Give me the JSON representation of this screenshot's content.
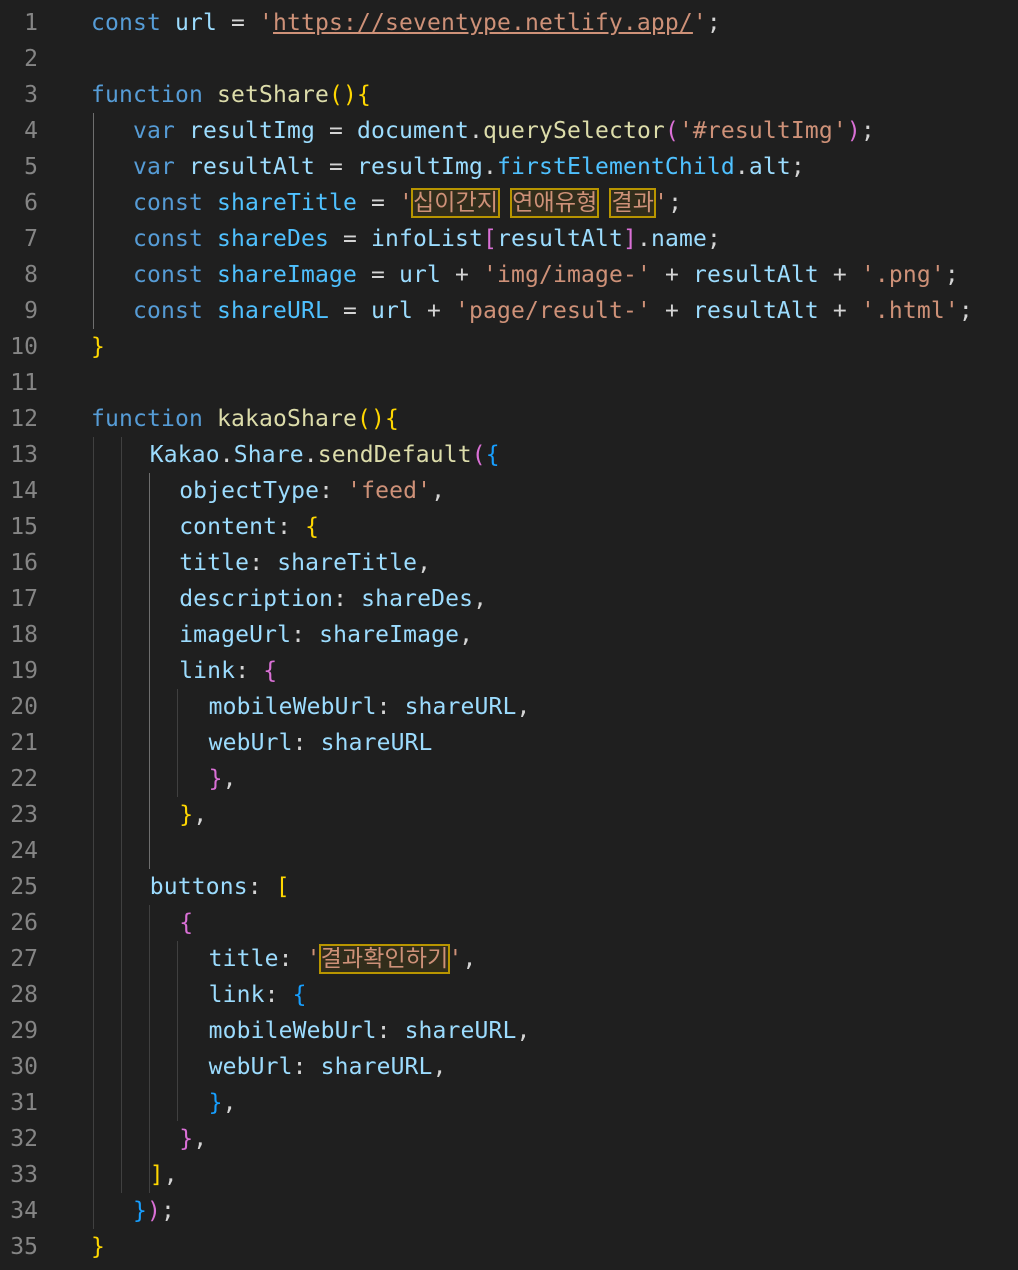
{
  "editor": {
    "lines": [
      {
        "n": "1",
        "tokens": [
          {
            "t": "const",
            "c": "kw"
          },
          {
            "t": " "
          },
          {
            "t": "url",
            "c": "var"
          },
          {
            "t": " = ",
            "c": "op"
          },
          {
            "t": "'",
            "c": "str"
          },
          {
            "t": "https://seventype.netlify.app/",
            "c": "str link"
          },
          {
            "t": "'",
            "c": "str"
          },
          {
            "t": ";",
            "c": "punc"
          }
        ],
        "indent": 0
      },
      {
        "n": "2",
        "tokens": [],
        "indent": 0
      },
      {
        "n": "3",
        "tokens": [
          {
            "t": "function",
            "c": "kw"
          },
          {
            "t": " "
          },
          {
            "t": "setShare",
            "c": "fn"
          },
          {
            "t": "()",
            "c": "b1"
          },
          {
            "t": "{",
            "c": "b1"
          }
        ],
        "indent": 0
      },
      {
        "n": "4",
        "tokens": [
          {
            "t": "var",
            "c": "kw"
          },
          {
            "t": " "
          },
          {
            "t": "resultImg",
            "c": "var"
          },
          {
            "t": " = ",
            "c": "op"
          },
          {
            "t": "document",
            "c": "var"
          },
          {
            "t": ".",
            "c": "punc"
          },
          {
            "t": "querySelector",
            "c": "fn"
          },
          {
            "t": "(",
            "c": "b2"
          },
          {
            "t": "'#resultImg'",
            "c": "str"
          },
          {
            "t": ")",
            "c": "b2"
          },
          {
            "t": ";",
            "c": "punc"
          }
        ],
        "indent": 1
      },
      {
        "n": "5",
        "tokens": [
          {
            "t": "var",
            "c": "kw"
          },
          {
            "t": " "
          },
          {
            "t": "resultAlt",
            "c": "var"
          },
          {
            "t": " = ",
            "c": "op"
          },
          {
            "t": "resultImg",
            "c": "var"
          },
          {
            "t": ".",
            "c": "punc"
          },
          {
            "t": "firstElementChild",
            "c": "const"
          },
          {
            "t": ".",
            "c": "punc"
          },
          {
            "t": "alt",
            "c": "var"
          },
          {
            "t": ";",
            "c": "punc"
          }
        ],
        "indent": 1
      },
      {
        "n": "6",
        "tokens": [
          {
            "t": "const",
            "c": "kw"
          },
          {
            "t": " "
          },
          {
            "t": "shareTitle",
            "c": "const"
          },
          {
            "t": " = ",
            "c": "op"
          },
          {
            "t": "'",
            "c": "str"
          },
          {
            "t": "십이간지",
            "c": "str hl"
          },
          {
            "t": " ",
            "c": "str"
          },
          {
            "t": "연애유형",
            "c": "str hl"
          },
          {
            "t": " ",
            "c": "str"
          },
          {
            "t": "결과",
            "c": "str hl"
          },
          {
            "t": "'",
            "c": "str"
          },
          {
            "t": ";",
            "c": "punc"
          }
        ],
        "indent": 1
      },
      {
        "n": "7",
        "tokens": [
          {
            "t": "const",
            "c": "kw"
          },
          {
            "t": " "
          },
          {
            "t": "shareDes",
            "c": "const"
          },
          {
            "t": " = ",
            "c": "op"
          },
          {
            "t": "infoList",
            "c": "var"
          },
          {
            "t": "[",
            "c": "b2"
          },
          {
            "t": "resultAlt",
            "c": "var"
          },
          {
            "t": "]",
            "c": "b2"
          },
          {
            "t": ".",
            "c": "punc"
          },
          {
            "t": "name",
            "c": "var"
          },
          {
            "t": ";",
            "c": "punc"
          }
        ],
        "indent": 1
      },
      {
        "n": "8",
        "tokens": [
          {
            "t": "const",
            "c": "kw"
          },
          {
            "t": " "
          },
          {
            "t": "shareImage",
            "c": "const"
          },
          {
            "t": " = ",
            "c": "op"
          },
          {
            "t": "url",
            "c": "var"
          },
          {
            "t": " + ",
            "c": "op"
          },
          {
            "t": "'img/image-'",
            "c": "str"
          },
          {
            "t": " + ",
            "c": "op"
          },
          {
            "t": "resultAlt",
            "c": "var"
          },
          {
            "t": " + ",
            "c": "op"
          },
          {
            "t": "'.png'",
            "c": "str"
          },
          {
            "t": ";",
            "c": "punc"
          }
        ],
        "indent": 1
      },
      {
        "n": "9",
        "tokens": [
          {
            "t": "const",
            "c": "kw"
          },
          {
            "t": " "
          },
          {
            "t": "shareURL",
            "c": "const"
          },
          {
            "t": " = ",
            "c": "op"
          },
          {
            "t": "url",
            "c": "var"
          },
          {
            "t": " + ",
            "c": "op"
          },
          {
            "t": "'page/result-'",
            "c": "str"
          },
          {
            "t": " + ",
            "c": "op"
          },
          {
            "t": "resultAlt",
            "c": "var"
          },
          {
            "t": " + ",
            "c": "op"
          },
          {
            "t": "'.html'",
            "c": "str"
          },
          {
            "t": ";",
            "c": "punc"
          }
        ],
        "indent": 1
      },
      {
        "n": "10",
        "tokens": [
          {
            "t": "}",
            "c": "b1"
          }
        ],
        "indent": 0
      },
      {
        "n": "11",
        "tokens": [],
        "indent": 0
      },
      {
        "n": "12",
        "tokens": [
          {
            "t": "function",
            "c": "kw"
          },
          {
            "t": " "
          },
          {
            "t": "kakaoShare",
            "c": "fn"
          },
          {
            "t": "()",
            "c": "b1"
          },
          {
            "t": "{",
            "c": "b1"
          }
        ],
        "indent": 0
      },
      {
        "n": "13",
        "tokens": [
          {
            "t": "Kakao",
            "c": "var"
          },
          {
            "t": ".",
            "c": "punc"
          },
          {
            "t": "Share",
            "c": "var"
          },
          {
            "t": ".",
            "c": "punc"
          },
          {
            "t": "sendDefault",
            "c": "fn"
          },
          {
            "t": "(",
            "c": "b2"
          },
          {
            "t": "{",
            "c": "b3"
          }
        ],
        "indent": 1.4
      },
      {
        "n": "14",
        "tokens": [
          {
            "t": "objectType",
            "c": "prop"
          },
          {
            "t": ": ",
            "c": "punc"
          },
          {
            "t": "'feed'",
            "c": "str"
          },
          {
            "t": ",",
            "c": "punc"
          }
        ],
        "indent": 2.1
      },
      {
        "n": "15",
        "tokens": [
          {
            "t": "content",
            "c": "prop"
          },
          {
            "t": ": ",
            "c": "punc"
          },
          {
            "t": "{",
            "c": "b1"
          }
        ],
        "indent": 2.1
      },
      {
        "n": "16",
        "tokens": [
          {
            "t": "title",
            "c": "prop"
          },
          {
            "t": ": ",
            "c": "punc"
          },
          {
            "t": "shareTitle",
            "c": "var"
          },
          {
            "t": ",",
            "c": "punc"
          }
        ],
        "indent": 2.1
      },
      {
        "n": "17",
        "tokens": [
          {
            "t": "description",
            "c": "prop"
          },
          {
            "t": ": ",
            "c": "punc"
          },
          {
            "t": "shareDes",
            "c": "var"
          },
          {
            "t": ",",
            "c": "punc"
          }
        ],
        "indent": 2.1
      },
      {
        "n": "18",
        "tokens": [
          {
            "t": "imageUrl",
            "c": "prop"
          },
          {
            "t": ": ",
            "c": "punc"
          },
          {
            "t": "shareImage",
            "c": "var"
          },
          {
            "t": ",",
            "c": "punc"
          }
        ],
        "indent": 2.1
      },
      {
        "n": "19",
        "tokens": [
          {
            "t": "link",
            "c": "prop"
          },
          {
            "t": ": ",
            "c": "punc"
          },
          {
            "t": "{",
            "c": "b2"
          }
        ],
        "indent": 2.1
      },
      {
        "n": "20",
        "tokens": [
          {
            "t": "mobileWebUrl",
            "c": "prop"
          },
          {
            "t": ": ",
            "c": "punc"
          },
          {
            "t": "shareURL",
            "c": "var"
          },
          {
            "t": ",",
            "c": "punc"
          }
        ],
        "indent": 2.8
      },
      {
        "n": "21",
        "tokens": [
          {
            "t": "webUrl",
            "c": "prop"
          },
          {
            "t": ": ",
            "c": "punc"
          },
          {
            "t": "shareURL",
            "c": "var"
          }
        ],
        "indent": 2.8
      },
      {
        "n": "22",
        "tokens": [
          {
            "t": "}",
            "c": "b2"
          },
          {
            "t": ",",
            "c": "punc"
          }
        ],
        "indent": 2.8
      },
      {
        "n": "23",
        "tokens": [
          {
            "t": "}",
            "c": "b1"
          },
          {
            "t": ",",
            "c": "punc"
          }
        ],
        "indent": 2.1
      },
      {
        "n": "24",
        "tokens": [],
        "indent": 0
      },
      {
        "n": "25",
        "tokens": [
          {
            "t": "buttons",
            "c": "prop"
          },
          {
            "t": ": ",
            "c": "punc"
          },
          {
            "t": "[",
            "c": "b1"
          }
        ],
        "indent": 1.4
      },
      {
        "n": "26",
        "tokens": [
          {
            "t": "{",
            "c": "b2"
          }
        ],
        "indent": 2.1
      },
      {
        "n": "27",
        "tokens": [
          {
            "t": "title",
            "c": "prop"
          },
          {
            "t": ": ",
            "c": "punc"
          },
          {
            "t": "'",
            "c": "str"
          },
          {
            "t": "결과확인하기",
            "c": "str hl"
          },
          {
            "t": "'",
            "c": "str"
          },
          {
            "t": ",",
            "c": "punc"
          }
        ],
        "indent": 2.8
      },
      {
        "n": "28",
        "tokens": [
          {
            "t": "link",
            "c": "prop"
          },
          {
            "t": ": ",
            "c": "punc"
          },
          {
            "t": "{",
            "c": "b3"
          }
        ],
        "indent": 2.8
      },
      {
        "n": "29",
        "tokens": [
          {
            "t": "mobileWebUrl",
            "c": "prop"
          },
          {
            "t": ": ",
            "c": "punc"
          },
          {
            "t": "shareURL",
            "c": "var"
          },
          {
            "t": ",",
            "c": "punc"
          }
        ],
        "indent": 2.8
      },
      {
        "n": "30",
        "tokens": [
          {
            "t": "webUrl",
            "c": "prop"
          },
          {
            "t": ": ",
            "c": "punc"
          },
          {
            "t": "shareURL",
            "c": "var"
          },
          {
            "t": ",",
            "c": "punc"
          }
        ],
        "indent": 2.8
      },
      {
        "n": "31",
        "tokens": [
          {
            "t": "}",
            "c": "b3"
          },
          {
            "t": ",",
            "c": "punc"
          }
        ],
        "indent": 2.8
      },
      {
        "n": "32",
        "tokens": [
          {
            "t": "}",
            "c": "b2"
          },
          {
            "t": ",",
            "c": "punc"
          }
        ],
        "indent": 2.1
      },
      {
        "n": "33",
        "tokens": [
          {
            "t": "]",
            "c": "b1"
          },
          {
            "t": ",",
            "c": "punc"
          }
        ],
        "indent": 1.4
      },
      {
        "n": "34",
        "tokens": [
          {
            "t": "}",
            "c": "b3"
          },
          {
            "t": ")",
            "c": "b2"
          },
          {
            "t": ";",
            "c": "punc"
          }
        ],
        "indent": 1
      },
      {
        "n": "35",
        "tokens": [
          {
            "t": "}",
            "c": "b1"
          }
        ],
        "indent": 0
      }
    ]
  }
}
